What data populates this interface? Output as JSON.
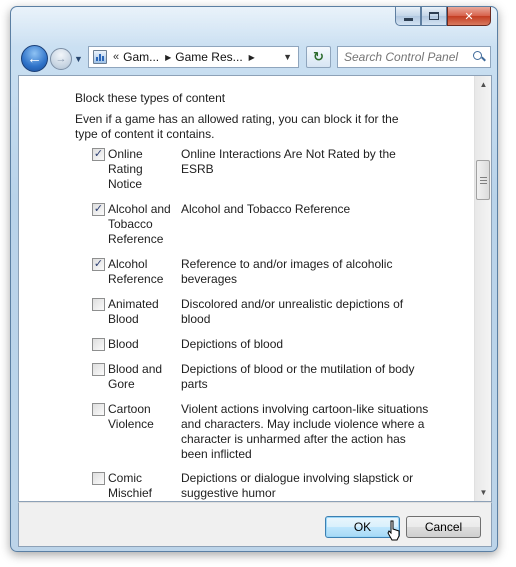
{
  "window": {
    "caption_buttons": [
      {
        "name": "minimize",
        "icon": "minimize-icon"
      },
      {
        "name": "maximize",
        "icon": "maximize-icon"
      },
      {
        "name": "close",
        "icon": "close-icon",
        "glyph": "✕"
      }
    ]
  },
  "nav": {
    "back_glyph": "←",
    "forward_glyph": "→",
    "dropdown_glyph": "▼"
  },
  "address": {
    "prefix": "«",
    "crumbs": [
      "Gam...",
      "Game Res..."
    ],
    "separator": "▶",
    "dropdown_glyph": "▼"
  },
  "refresh_glyph": "↻",
  "search": {
    "placeholder": "Search Control Panel"
  },
  "content": {
    "section_title": "Block these types of content",
    "description": "Even if a game has an allowed rating, you can block it for the type of content it contains.",
    "items": [
      {
        "label": "Online Rating Notice",
        "desc": "Online Interactions Are Not Rated by the ESRB",
        "checked": true
      },
      {
        "label": "Alcohol and Tobacco Reference",
        "desc": "Alcohol and Tobacco Reference",
        "checked": true
      },
      {
        "label": "Alcohol Reference",
        "desc": "Reference to and/or images of alcoholic beverages",
        "checked": true
      },
      {
        "label": "Animated Blood",
        "desc": "Discolored and/or unrealistic depictions of blood",
        "checked": false
      },
      {
        "label": "Blood",
        "desc": "Depictions of blood",
        "checked": false
      },
      {
        "label": "Blood and Gore",
        "desc": "Depictions of blood or the mutilation of body parts",
        "checked": false
      },
      {
        "label": "Cartoon Violence",
        "desc": "Violent actions involving cartoon-like situations and characters. May include violence where a character is unharmed after the action has been inflicted",
        "checked": false
      },
      {
        "label": "Comic Mischief",
        "desc": "Depictions or dialogue involving slapstick or suggestive humor",
        "checked": false
      }
    ],
    "check_glyph": "✓"
  },
  "scrollbar": {
    "up_glyph": "▲",
    "down_glyph": "▼"
  },
  "footer": {
    "ok_label": "OK",
    "cancel_label": "Cancel"
  }
}
